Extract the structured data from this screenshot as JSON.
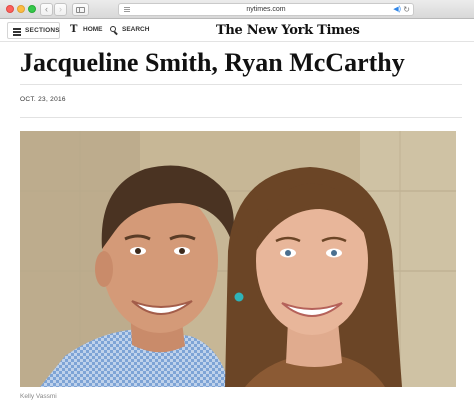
{
  "browser": {
    "address": "nytimes.com"
  },
  "nav": {
    "sections_label": "SECTIONS",
    "home_glyph": "T",
    "home_label": "HOME",
    "search_label": "SEARCH",
    "masthead": "The New York Times"
  },
  "article": {
    "headline": "Jacqueline Smith, Ryan McCarthy",
    "date": "OCT. 23, 2016",
    "photo_credit": "Kelly Vassmi"
  },
  "colors": {
    "close": "#fc605c",
    "minimize": "#fdbc40",
    "maximize": "#34c84a",
    "accent": "#2f86e8"
  },
  "icons": [
    "close-icon",
    "minimize-icon",
    "maximize-icon",
    "back-arrow-icon",
    "forward-arrow-icon",
    "sidebar-icon",
    "reader-menu-icon",
    "speaker-icon",
    "reload-icon",
    "hamburger-icon",
    "nyt-t-icon",
    "search-icon"
  ]
}
